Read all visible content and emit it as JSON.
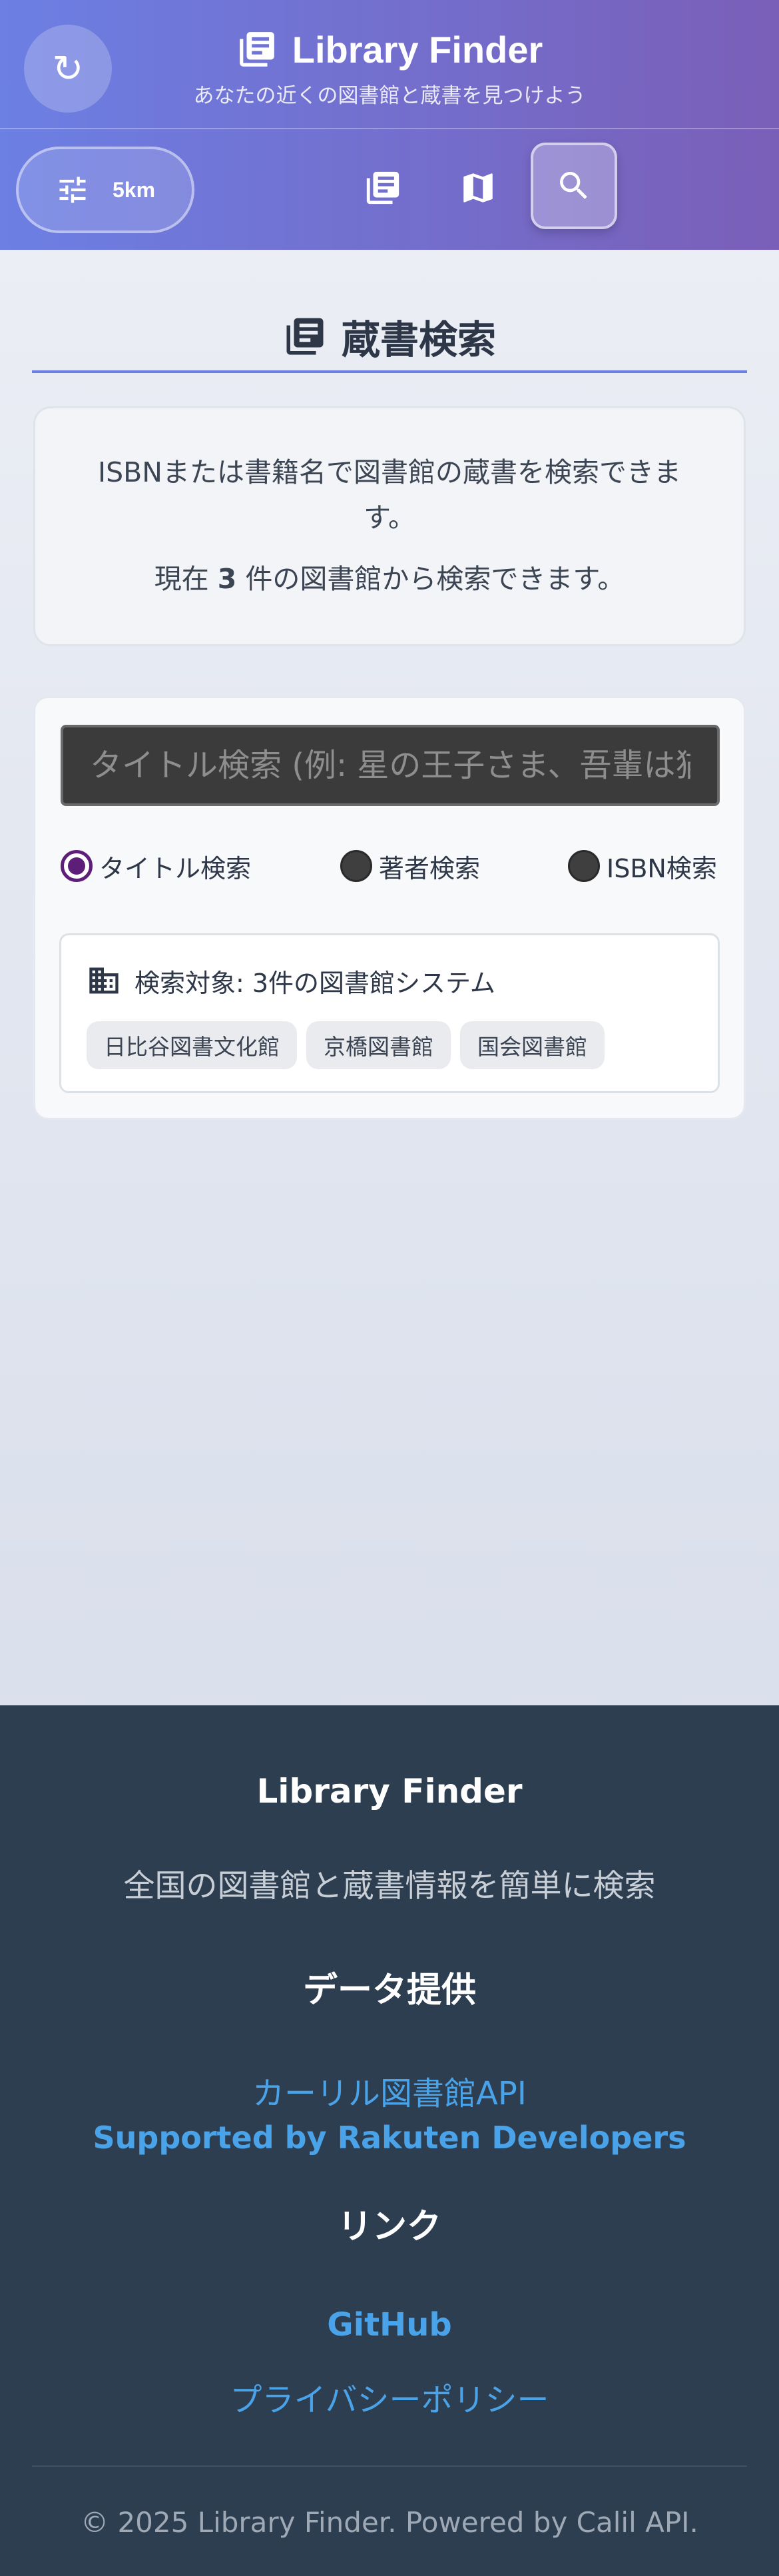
{
  "header": {
    "title": "Library Finder",
    "subtitle": "あなたの近くの図書館と蔵書を見つけよう",
    "range_label": "5km"
  },
  "search_section": {
    "title": "蔵書検索",
    "info_line1": "ISBNまたは書籍名で図書館の蔵書を検索できます。",
    "info_prefix": "現在 ",
    "info_count": "3",
    "info_suffix": " 件の図書館から検索できます。",
    "search_placeholder": "タイトル検索 (例: 星の王子さま、吾輩は猫",
    "search_value": "",
    "radio_options": [
      {
        "label": "タイトル検索",
        "checked": true
      },
      {
        "label": "著者検索",
        "checked": false
      },
      {
        "label": "ISBN検索",
        "checked": false
      }
    ],
    "target_label": "検索対象: 3件の図書館システム",
    "libraries": [
      "日比谷図書文化館",
      "京橋図書館",
      "国会図書館"
    ]
  },
  "footer": {
    "title": "Library Finder",
    "description": "全国の図書館と蔵書情報を簡単に検索",
    "data_heading": "データ提供",
    "data_links": [
      "カーリル図書館API",
      "Supported by Rakuten Developers"
    ],
    "links_heading": "リンク",
    "links": [
      "GitHub",
      "プライバシーポリシー"
    ],
    "copyright": "© 2025 Library Finder. Powered by Calil API."
  },
  "colors": {
    "header_start": "#6c7fe3",
    "header_end": "#7a5fb8",
    "accent": "#6b7fe0",
    "footer_bg": "#2d3e50",
    "link": "#4aa3e8",
    "radio_checked": "#5c1e78"
  },
  "icons": [
    "refresh-icon",
    "book-stack-icon",
    "sliders-icon",
    "library-icon",
    "map-icon",
    "search-icon",
    "building-icon"
  ]
}
